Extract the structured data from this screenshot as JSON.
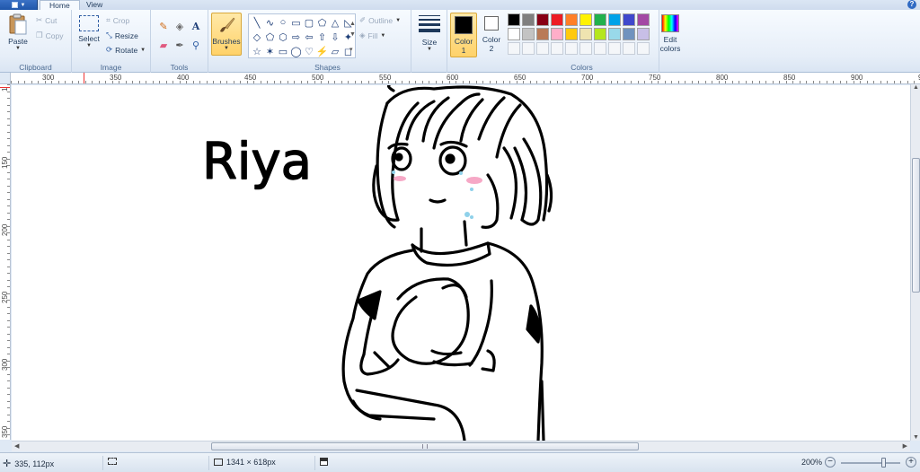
{
  "window": {
    "tabs": [
      {
        "label": "Home",
        "active": true
      },
      {
        "label": "View",
        "active": false
      }
    ],
    "help_glyph": "?"
  },
  "ribbon": {
    "clipboard": {
      "label": "Clipboard",
      "paste": "Paste",
      "cut": "Cut",
      "copy": "Copy"
    },
    "image": {
      "label": "Image",
      "select": "Select",
      "crop": "Crop",
      "resize": "Resize",
      "rotate": "Rotate"
    },
    "tools": {
      "label": "Tools",
      "items": [
        "pencil-icon",
        "fill-icon",
        "text-icon",
        "eraser-icon",
        "color-picker-icon",
        "magnifier-icon"
      ],
      "text_glyph": "A"
    },
    "brushes": {
      "label": "Brushes"
    },
    "shapes": {
      "label": "Shapes",
      "outline": "Outline",
      "fill": "Fill",
      "glyphs": [
        "╲",
        "∿",
        "○",
        "▭",
        "▢",
        "⬠",
        "△",
        "◺",
        "◇",
        "⬠",
        "⬡",
        "⇨",
        "⇦",
        "⇧",
        "⇩",
        "✦",
        "☆",
        "✶",
        "▭",
        "◯",
        "♡",
        "⚡",
        "▱",
        "◻"
      ]
    },
    "size": {
      "label": "Size"
    },
    "color1": {
      "label": "Color",
      "number": "1",
      "color": "#000000"
    },
    "color2": {
      "label": "Color",
      "number": "2",
      "color": "#ffffff"
    },
    "colors": {
      "label": "Colors",
      "row1": [
        "#000000",
        "#7f7f7f",
        "#880015",
        "#ed1c24",
        "#ff7f27",
        "#fff200",
        "#22b14c",
        "#00a2e8",
        "#3f48cc",
        "#a349a4"
      ],
      "row2": [
        "#ffffff",
        "#c3c3c3",
        "#b97a57",
        "#ffaec9",
        "#ffc90e",
        "#efe4b0",
        "#b5e61d",
        "#99d9ea",
        "#7092be",
        "#c8bfe7"
      ],
      "row3_empty": 10
    },
    "edit_colors": {
      "line1": "Edit",
      "line2": "colors"
    }
  },
  "ruler": {
    "h_labels": [
      "300",
      "350",
      "400",
      "450",
      "500",
      "550",
      "600",
      "650",
      "700",
      "750",
      "800",
      "850",
      "900",
      "95"
    ],
    "v_labels": [
      "150",
      "200",
      "250",
      "300",
      "350"
    ],
    "top_left": "1"
  },
  "canvas": {
    "text": "Riya"
  },
  "status": {
    "cursor_pos": "335, 112px",
    "image_size": "1341 × 618px",
    "zoom": "200%",
    "zoom_level": 0.72
  }
}
